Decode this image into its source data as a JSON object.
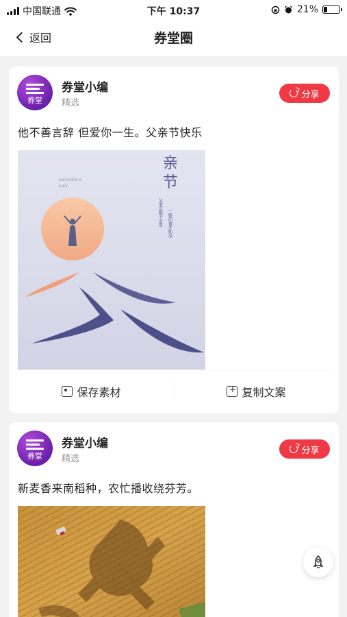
{
  "status": {
    "carrier": "中国联通",
    "time": "下午 10:37",
    "battery": "21%",
    "battery_level": 0.21
  },
  "nav": {
    "back_label": "返回",
    "title": "券堂圈"
  },
  "posts": [
    {
      "author": "券堂小编",
      "tag": "精选",
      "avatar_text": "券堂",
      "share_label": "分享",
      "text": "他不善言辞 但爱你一生。父亲节快乐",
      "image_text": {
        "title_line1": "亲",
        "title_line2": "节",
        "subtitle_en_1": "FATHER'S",
        "subtitle_en_2": "DAY",
        "poem_1": "父爱沉默不言意",
        "poem_2": "一朝回首才知深",
        "big_char": "父"
      },
      "actions": {
        "save": "保存素材",
        "copy": "复制文案"
      }
    },
    {
      "author": "券堂小编",
      "tag": "精选",
      "avatar_text": "券堂",
      "share_label": "分享",
      "text": "新麦香来南稻种，农忙播收绕芬芳。"
    }
  ],
  "colors": {
    "accent": "#ef3a45",
    "avatar": "#7a28b8"
  }
}
